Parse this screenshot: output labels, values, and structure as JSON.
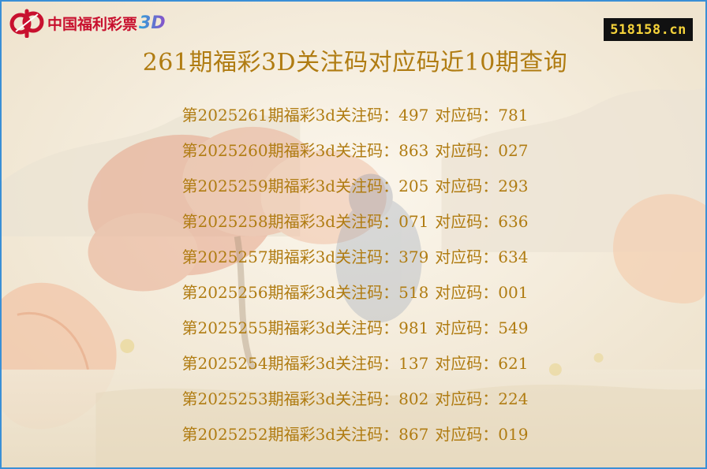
{
  "branding": {
    "logo_text": "中国福利彩票",
    "logo_suffix": "3D",
    "logo_color": "#c8102e",
    "site": "518158.cn"
  },
  "title": "261期福彩3D关注码对应码近10期查询",
  "colors": {
    "text": "#b07c12",
    "border": "#3a8fd6",
    "badge_bg": "#111111",
    "badge_text": "#f4d23a"
  },
  "rows": [
    {
      "period": "第2025261期福彩3d关注码：497",
      "corr": "对应码：781"
    },
    {
      "period": "第2025260期福彩3d关注码：863",
      "corr": "对应码：027"
    },
    {
      "period": "第2025259期福彩3d关注码：205",
      "corr": "对应码：293"
    },
    {
      "period": "第2025258期福彩3d关注码：071",
      "corr": "对应码：636"
    },
    {
      "period": "第2025257期福彩3d关注码：379",
      "corr": "对应码：634"
    },
    {
      "period": "第2025256期福彩3d关注码：518",
      "corr": "对应码：001"
    },
    {
      "period": "第2025255期福彩3d关注码：981",
      "corr": "对应码：549"
    },
    {
      "period": "第2025254期福彩3d关注码：137",
      "corr": "对应码：621"
    },
    {
      "period": "第2025253期福彩3d关注码：802",
      "corr": "对应码：224"
    },
    {
      "period": "第2025252期福彩3d关注码：867",
      "corr": "对应码：019"
    }
  ]
}
